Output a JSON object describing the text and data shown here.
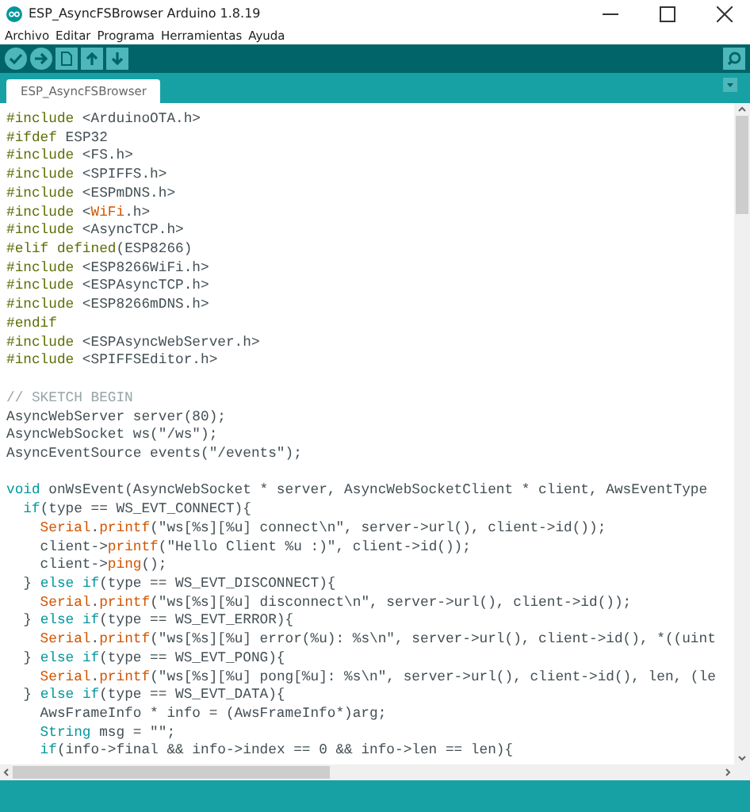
{
  "window": {
    "title": "ESP_AsyncFSBrowser Arduino 1.8.19"
  },
  "menu": [
    "Archivo",
    "Editar",
    "Programa",
    "Herramientas",
    "Ayuda"
  ],
  "tabs": [
    {
      "label": "ESP_AsyncFSBrowser",
      "selected": true
    }
  ],
  "code": [
    {
      "kind": "code",
      "segments": [
        {
          "text": "#include",
          "kind": "pre"
        },
        {
          "text": " <ArduinoOTA.h>",
          "kind": "plain"
        }
      ]
    },
    {
      "kind": "code",
      "segments": [
        {
          "text": "#ifdef",
          "kind": "pre"
        },
        {
          "text": " ESP32",
          "kind": "plain"
        }
      ]
    },
    {
      "kind": "code",
      "segments": [
        {
          "text": "#include",
          "kind": "pre"
        },
        {
          "text": " <FS.h>",
          "kind": "plain"
        }
      ]
    },
    {
      "kind": "code",
      "segments": [
        {
          "text": "#include",
          "kind": "pre"
        },
        {
          "text": " <SPIFFS.h>",
          "kind": "plain"
        }
      ]
    },
    {
      "kind": "code",
      "segments": [
        {
          "text": "#include",
          "kind": "pre"
        },
        {
          "text": " <ESPmDNS.h>",
          "kind": "plain"
        }
      ]
    },
    {
      "kind": "code",
      "segments": [
        {
          "text": "#include",
          "kind": "pre"
        },
        {
          "text": " <",
          "kind": "plain"
        },
        {
          "text": "WiFi",
          "kind": "fn"
        },
        {
          "text": ".h>",
          "kind": "plain"
        }
      ]
    },
    {
      "kind": "code",
      "segments": [
        {
          "text": "#include",
          "kind": "pre"
        },
        {
          "text": " <AsyncTCP.h>",
          "kind": "plain"
        }
      ]
    },
    {
      "kind": "code",
      "segments": [
        {
          "text": "#elif defined",
          "kind": "pre"
        },
        {
          "text": "(ESP8266)",
          "kind": "plain"
        }
      ]
    },
    {
      "kind": "code",
      "segments": [
        {
          "text": "#include",
          "kind": "pre"
        },
        {
          "text": " <ESP8266WiFi.h>",
          "kind": "plain"
        }
      ]
    },
    {
      "kind": "code",
      "segments": [
        {
          "text": "#include",
          "kind": "pre"
        },
        {
          "text": " <ESPAsyncTCP.h>",
          "kind": "plain"
        }
      ]
    },
    {
      "kind": "code",
      "segments": [
        {
          "text": "#include",
          "kind": "pre"
        },
        {
          "text": " <ESP8266mDNS.h>",
          "kind": "plain"
        }
      ]
    },
    {
      "kind": "code",
      "segments": [
        {
          "text": "#endif",
          "kind": "pre"
        }
      ]
    },
    {
      "kind": "code",
      "segments": [
        {
          "text": "#include",
          "kind": "pre"
        },
        {
          "text": " <ESPAsyncWebServer.h>",
          "kind": "plain"
        }
      ]
    },
    {
      "kind": "code",
      "segments": [
        {
          "text": "#include",
          "kind": "pre"
        },
        {
          "text": " <SPIFFSEditor.h>",
          "kind": "plain"
        }
      ]
    },
    {
      "kind": "blank"
    },
    {
      "kind": "code",
      "segments": [
        {
          "text": "// SKETCH BEGIN",
          "kind": "comment"
        }
      ]
    },
    {
      "kind": "code",
      "segments": [
        {
          "text": "AsyncWebServer server(80);",
          "kind": "plain"
        }
      ]
    },
    {
      "kind": "code",
      "segments": [
        {
          "text": "AsyncWebSocket ws(\"/ws\");",
          "kind": "plain"
        }
      ]
    },
    {
      "kind": "code",
      "segments": [
        {
          "text": "AsyncEventSource events(\"/events\");",
          "kind": "plain"
        }
      ]
    },
    {
      "kind": "blank"
    },
    {
      "kind": "code",
      "segments": [
        {
          "text": "void",
          "kind": "kw"
        },
        {
          "text": " onWsEvent(AsyncWebSocket * server, AsyncWebSocketClient * client, AwsEventType",
          "kind": "plain"
        }
      ]
    },
    {
      "kind": "code",
      "segments": [
        {
          "text": "  if",
          "kind": "kw"
        },
        {
          "text": "(type == WS_EVT_CONNECT){",
          "kind": "plain"
        }
      ]
    },
    {
      "kind": "code",
      "segments": [
        {
          "text": "    Serial",
          "kind": "fn"
        },
        {
          "text": ".",
          "kind": "plain"
        },
        {
          "text": "printf",
          "kind": "fn"
        },
        {
          "text": "(\"ws[%s][%u] connect\\n\", server->url(), client->id());",
          "kind": "plain"
        }
      ]
    },
    {
      "kind": "code",
      "segments": [
        {
          "text": "    client->",
          "kind": "plain"
        },
        {
          "text": "printf",
          "kind": "fn"
        },
        {
          "text": "(\"Hello Client %u :)\", client->id());",
          "kind": "plain"
        }
      ]
    },
    {
      "kind": "code",
      "segments": [
        {
          "text": "    client->",
          "kind": "plain"
        },
        {
          "text": "ping",
          "kind": "fn"
        },
        {
          "text": "();",
          "kind": "plain"
        }
      ]
    },
    {
      "kind": "code",
      "segments": [
        {
          "text": "  } ",
          "kind": "plain"
        },
        {
          "text": "else if",
          "kind": "kw"
        },
        {
          "text": "(type == WS_EVT_DISCONNECT){",
          "kind": "plain"
        }
      ]
    },
    {
      "kind": "code",
      "segments": [
        {
          "text": "    Serial",
          "kind": "fn"
        },
        {
          "text": ".",
          "kind": "plain"
        },
        {
          "text": "printf",
          "kind": "fn"
        },
        {
          "text": "(\"ws[%s][%u] disconnect\\n\", server->url(), client->id());",
          "kind": "plain"
        }
      ]
    },
    {
      "kind": "code",
      "segments": [
        {
          "text": "  } ",
          "kind": "plain"
        },
        {
          "text": "else if",
          "kind": "kw"
        },
        {
          "text": "(type == WS_EVT_ERROR){",
          "kind": "plain"
        }
      ]
    },
    {
      "kind": "code",
      "segments": [
        {
          "text": "    Serial",
          "kind": "fn"
        },
        {
          "text": ".",
          "kind": "plain"
        },
        {
          "text": "printf",
          "kind": "fn"
        },
        {
          "text": "(\"ws[%s][%u] error(%u): %s\\n\", server->url(), client->id(), *((uint",
          "kind": "plain"
        }
      ]
    },
    {
      "kind": "code",
      "segments": [
        {
          "text": "  } ",
          "kind": "plain"
        },
        {
          "text": "else if",
          "kind": "kw"
        },
        {
          "text": "(type == WS_EVT_PONG){",
          "kind": "plain"
        }
      ]
    },
    {
      "kind": "code",
      "segments": [
        {
          "text": "    Serial",
          "kind": "fn"
        },
        {
          "text": ".",
          "kind": "plain"
        },
        {
          "text": "printf",
          "kind": "fn"
        },
        {
          "text": "(\"ws[%s][%u] pong[%u]: %s\\n\", server->url(), client->id(), len, (le",
          "kind": "plain"
        }
      ]
    },
    {
      "kind": "code",
      "segments": [
        {
          "text": "  } ",
          "kind": "plain"
        },
        {
          "text": "else if",
          "kind": "kw"
        },
        {
          "text": "(type == WS_EVT_DATA){",
          "kind": "plain"
        }
      ]
    },
    {
      "kind": "code",
      "segments": [
        {
          "text": "    AwsFrameInfo * info = (AwsFrameInfo*)arg;",
          "kind": "plain"
        }
      ]
    },
    {
      "kind": "code",
      "segments": [
        {
          "text": "    String",
          "kind": "kw"
        },
        {
          "text": " msg = \"\";",
          "kind": "plain"
        }
      ]
    },
    {
      "kind": "code",
      "segments": [
        {
          "text": "    if",
          "kind": "kw"
        },
        {
          "text": "(info->final && info->index == 0 && info->len == len){",
          "kind": "plain"
        }
      ]
    }
  ]
}
